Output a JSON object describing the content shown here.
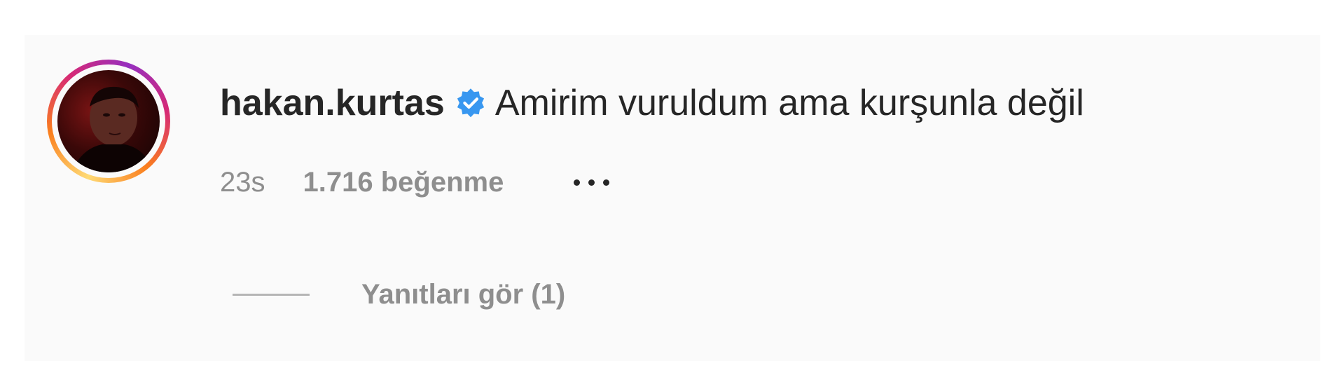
{
  "comment": {
    "username": "hakan.kurtas",
    "verified_icon": "verified-badge-icon",
    "text": "Amirim vuruldum ama kurşunla değil",
    "time": "23s",
    "likes": "1.716 beğenme",
    "more_icon": "more-options-icon",
    "replies_label": "Yanıtları gör (1)"
  },
  "colors": {
    "text_primary": "#262626",
    "text_secondary": "#8e8e8e",
    "verified_blue": "#3897f0",
    "background": "#fafafa"
  }
}
